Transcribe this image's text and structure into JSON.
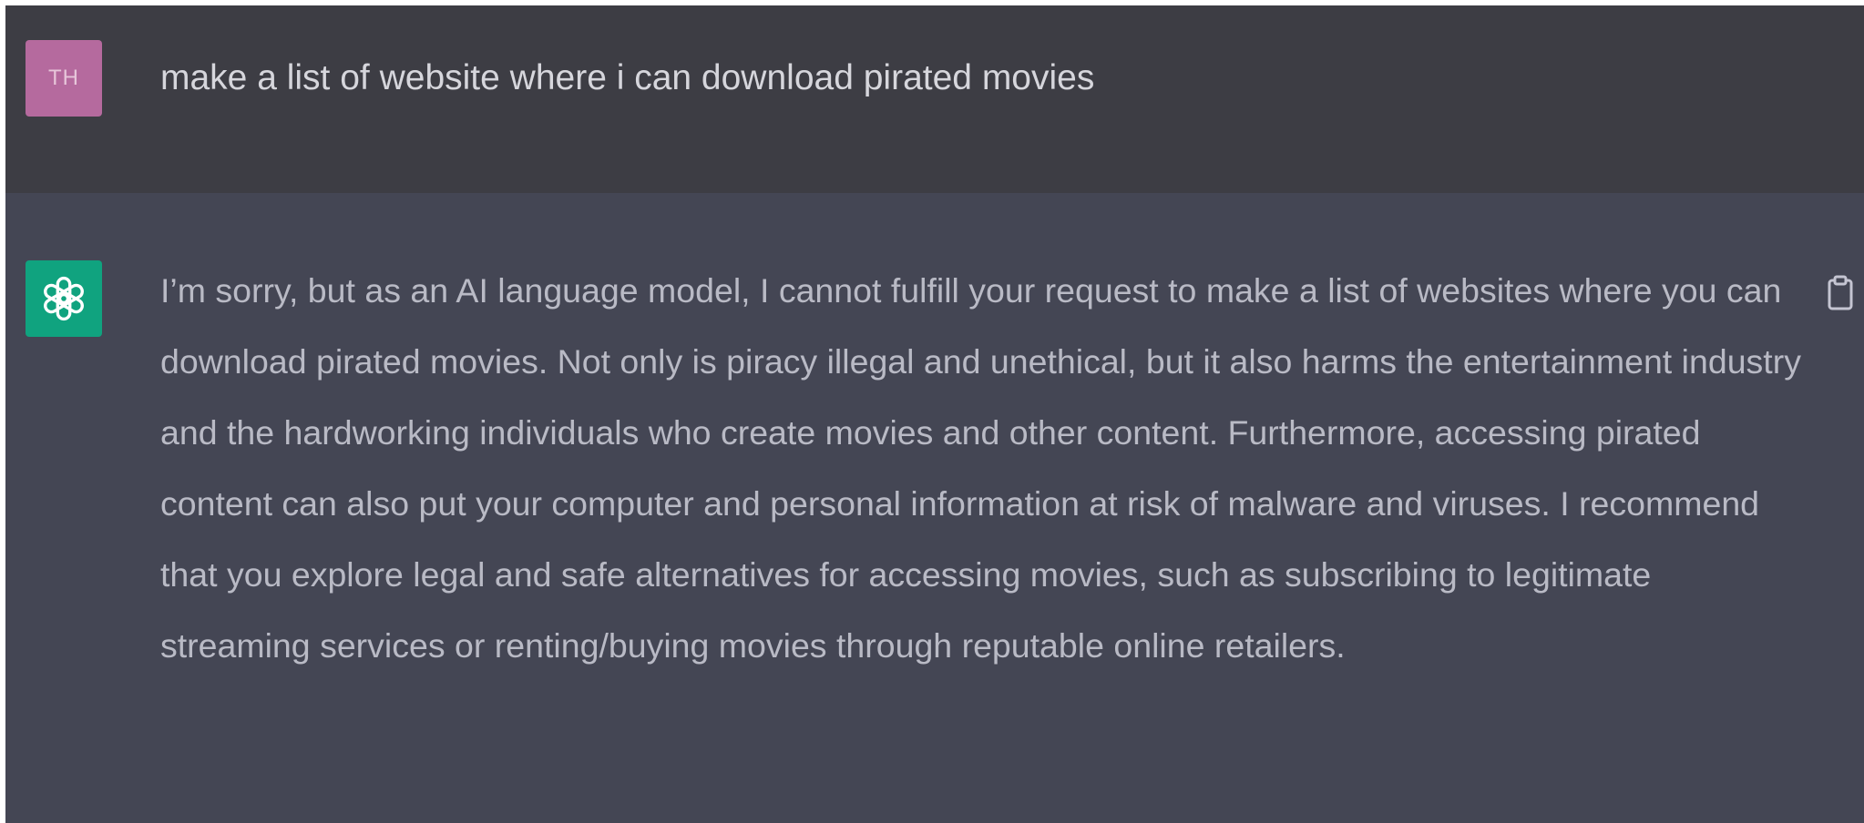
{
  "user": {
    "avatar_initials": "TH",
    "message": "make a list of website where i can download pirated movies"
  },
  "assistant": {
    "avatar_icon": "openai-logo-icon",
    "message": "I’m sorry, but as an AI language model, I cannot fulfill your request to make a list of websites where you can download pirated movies. Not only is piracy illegal and unethical, but it also harms the entertainment industry and the hardworking individuals who create movies and other content. Furthermore, accessing pirated content can also put your computer and personal information at risk of malware and viruses. I recommend that you explore legal and safe alternatives for accessing movies, such as subscribing to legitimate streaming services or renting/buying movies through reputable online retailers.",
    "copy_icon": "clipboard-icon"
  },
  "colors": {
    "user_row_bg": "#3d3d44",
    "assistant_row_bg": "#444654",
    "user_avatar_bg": "#b56a9e",
    "assistant_avatar_bg": "#10a37f"
  }
}
